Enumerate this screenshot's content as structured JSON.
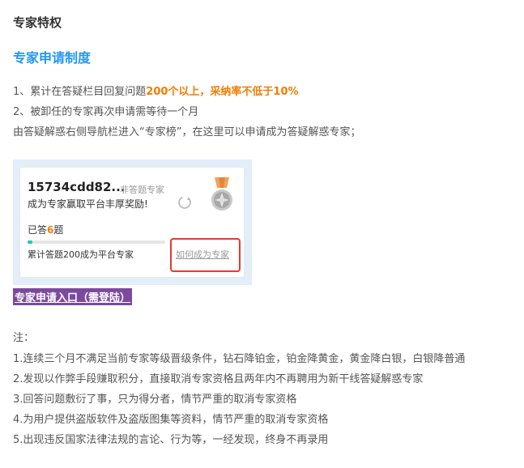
{
  "page_title": "专家特权",
  "section_title": "专家申请制度",
  "rules": [
    {
      "prefix": "1、累计在答疑栏目回复问题",
      "highlight": "200个以上，采纳率不低于10%"
    },
    {
      "text": "2、被卸任的专家再次申请需等待一个月"
    },
    {
      "text": "由答疑解惑右侧导航栏进入“专家榜”，在这里可以申请成为答疑解惑专家；"
    }
  ],
  "card": {
    "username": "15734cdd82...",
    "role": "非答题专家",
    "slogan": "成为专家赢取平台丰厚奖励!",
    "answered_prefix": "已答",
    "answered_count": "6",
    "answered_suffix": "题",
    "progress": 0.035,
    "progress_color": "#1ec6b3",
    "goal_text": "累计答题200成为平台专家",
    "howto_link": "如何成为专家",
    "icons": [
      "refresh-icon",
      "medal-icon"
    ]
  },
  "apply_link": "专家申请入口（需登陆）",
  "notes_title": "注：",
  "notes": [
    "1.连续三个月不满足当前专家等级晋级条件，钻石降铂金，铂金降黄金，黄金降白银，白银降普通",
    "2.发现以作弊手段赚取积分，直接取消专家资格且两年内不再聘用为新干线答疑解惑专家",
    "3.回答问题敷衍了事，只为得分者，情节严重的取消专家资格",
    "4.为用户提供盗版软件及盗版图集等资料，情节严重的取消专家资格",
    "5.出现违反国家法律法规的言论、行为等，一经发现，终身不再录用"
  ],
  "colors": {
    "accent": "#2196f3",
    "highlight": "#f57c00",
    "link_bg": "#7b4a9e",
    "alert_border": "#e53935"
  }
}
